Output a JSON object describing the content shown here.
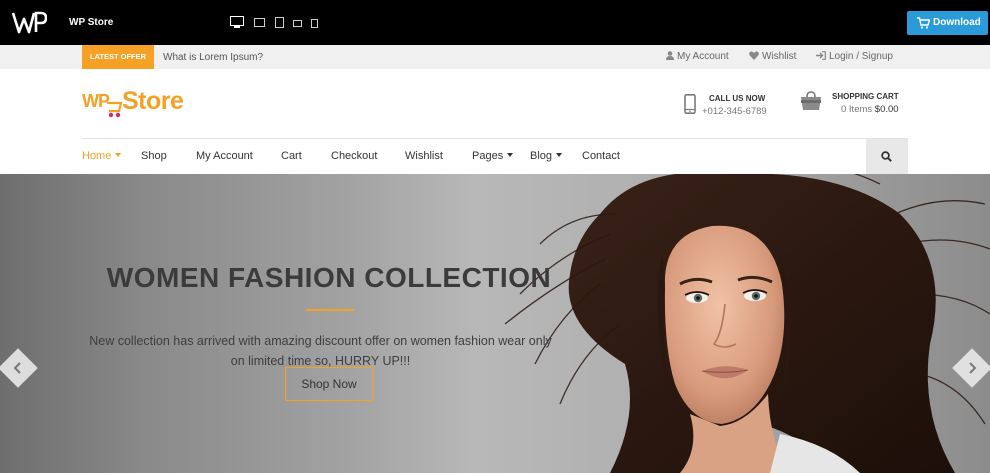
{
  "preview_bar": {
    "logo_text": "WP",
    "title": "WP Store",
    "download_label": "Download"
  },
  "top_strip": {
    "offer_badge": "LATEST OFFER",
    "offer_text": "What is Lorem Ipsum?",
    "links": [
      "My Account",
      "Wishlist",
      "Login / Signup"
    ]
  },
  "header": {
    "logo_wp": "WP",
    "logo_store": "Store",
    "call_title": "CALL US NOW",
    "call_number": "+012-345-6789",
    "cart_title": "SHOPPING CART",
    "cart_items": "0 Items",
    "cart_total": "$0.00"
  },
  "nav": {
    "items": [
      "Home",
      "Shop",
      "My Account",
      "Cart",
      "Checkout",
      "Wishlist",
      "Pages",
      "Blog",
      "Contact"
    ]
  },
  "hero": {
    "title": "WOMEN FASHION COLLECTION",
    "description": "New collection has arrived with amazing discount offer on women fashion wear only on limited time so, HURRY UP!!!",
    "button_label": "Shop Now"
  },
  "colors": {
    "accent": "#f4a125",
    "download": "#2a9bd8",
    "topbar": "#000000"
  },
  "icons": [
    "wp-logo-icon",
    "desktop-icon",
    "tablet-landscape-icon",
    "tablet-portrait-icon",
    "phone-landscape-icon",
    "phone-portrait-icon",
    "cart-icon",
    "user-icon",
    "heart-icon",
    "login-icon",
    "mobile-phone-icon",
    "shopping-bag-icon",
    "search-icon",
    "chevron-left-icon",
    "chevron-right-icon"
  ]
}
